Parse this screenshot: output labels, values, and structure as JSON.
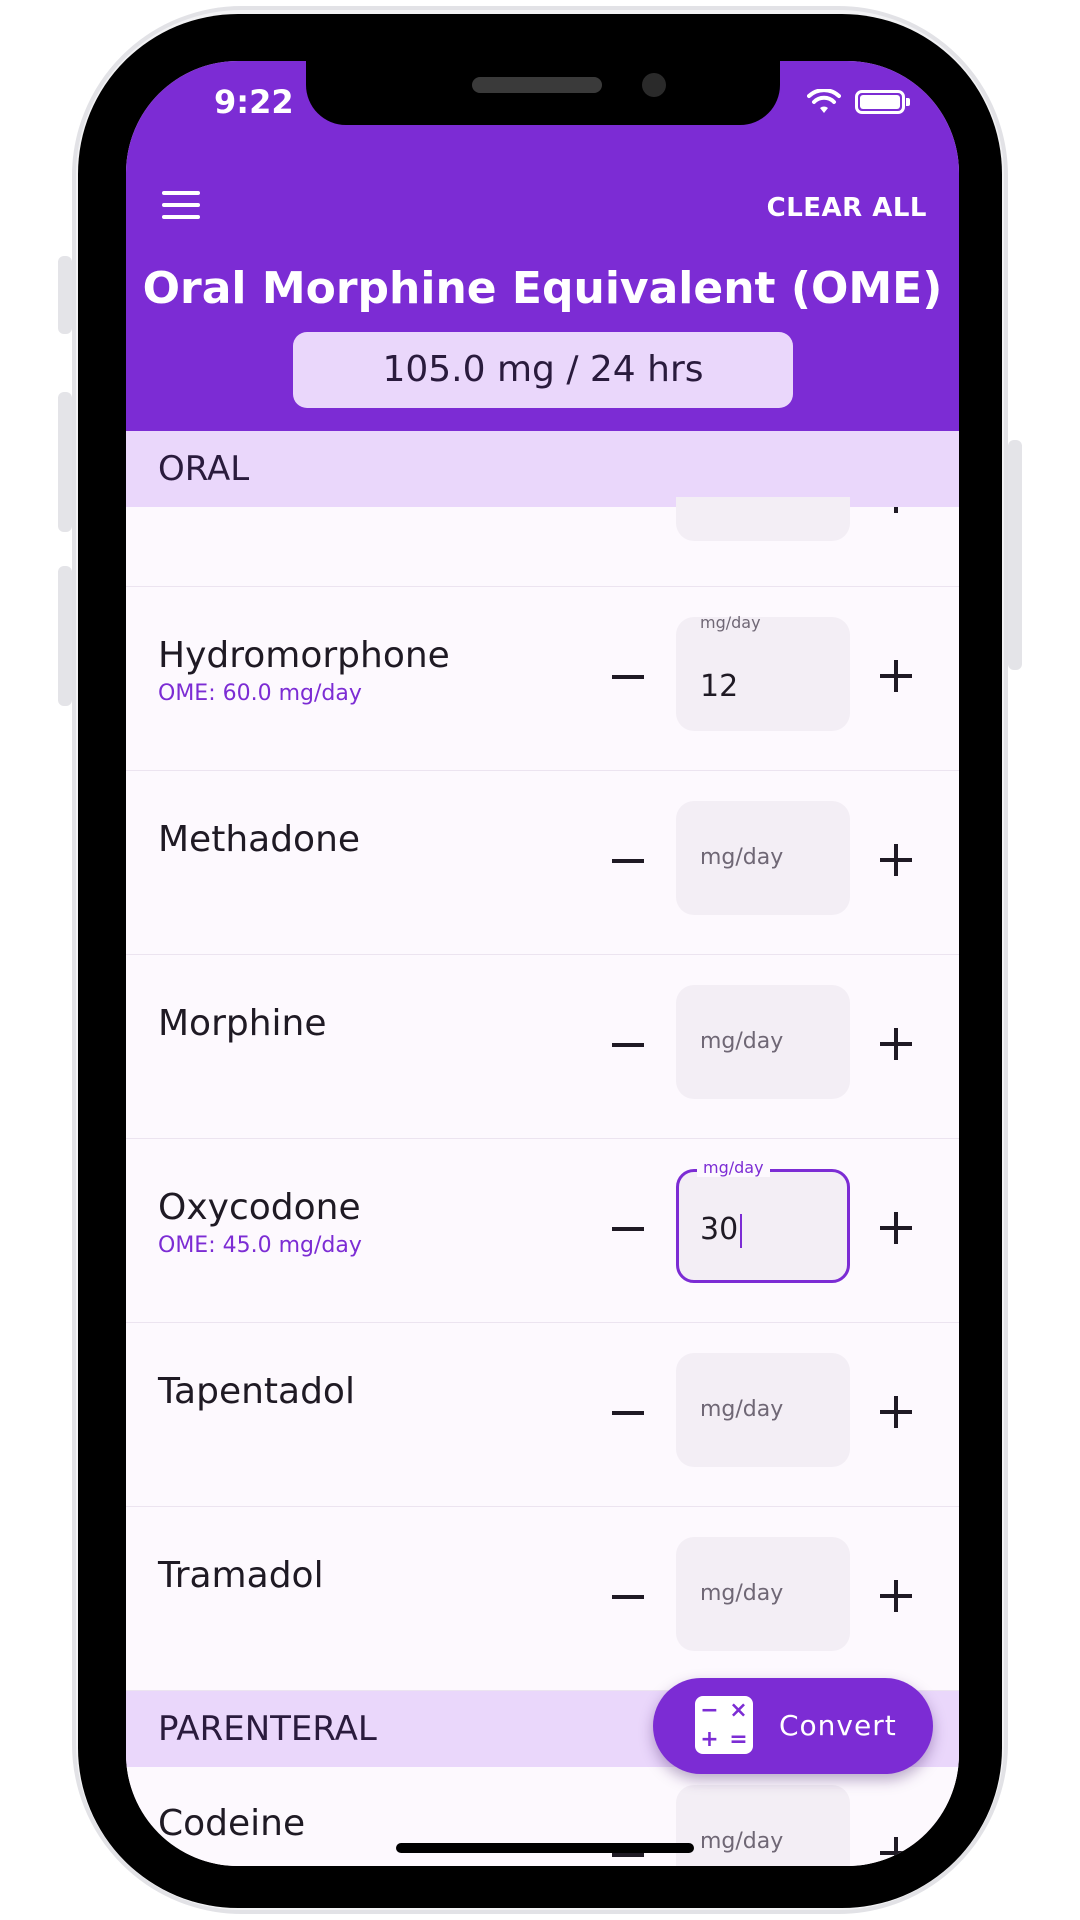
{
  "status_bar": {
    "time": "9:22"
  },
  "app_bar": {
    "clear_all_label": "CLEAR ALL",
    "title": "Oral Morphine Equivalent (OME)",
    "total": "105.0 mg / 24 hrs"
  },
  "sections": {
    "oral": "ORAL",
    "parenteral": "PARENTERAL"
  },
  "field_label": "mg/day",
  "drugs": [
    {
      "name": "Hydromorphone",
      "value": "12",
      "ome": "OME: 60.0 mg/day"
    },
    {
      "name": "Methadone",
      "value": "",
      "ome": ""
    },
    {
      "name": "Morphine",
      "value": "",
      "ome": ""
    },
    {
      "name": "Oxycodone",
      "value": "30",
      "ome": "OME: 45.0 mg/day"
    },
    {
      "name": "Tapentadol",
      "value": "",
      "ome": ""
    },
    {
      "name": "Tramadol",
      "value": "",
      "ome": ""
    }
  ],
  "parenteral_drugs": [
    {
      "name": "Codeine",
      "value": ""
    }
  ],
  "fab": {
    "label": "Convert",
    "icon": "calculator-icon"
  },
  "colors": {
    "primary": "#7c2cd4",
    "section_bg": "#ead7fb"
  }
}
